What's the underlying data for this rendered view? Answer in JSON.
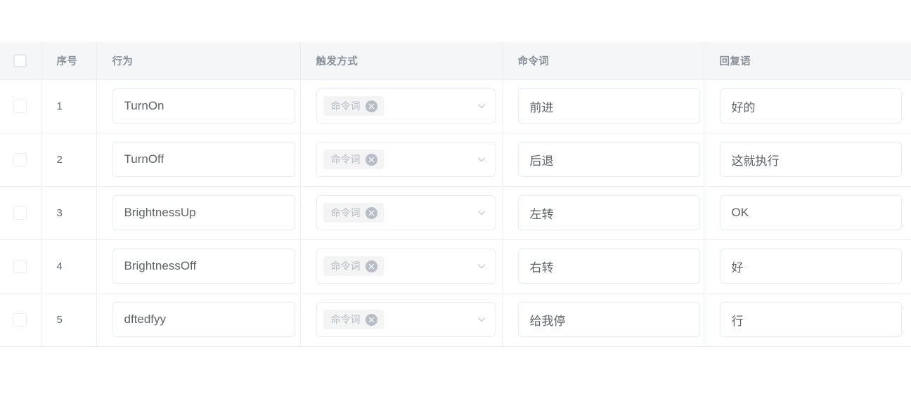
{
  "table": {
    "select_all_checkbox": "unchecked",
    "columns": [
      {
        "key": "check",
        "label": ""
      },
      {
        "key": "index",
        "label": "序号"
      },
      {
        "key": "action",
        "label": "行为"
      },
      {
        "key": "trigger",
        "label": "触发方式"
      },
      {
        "key": "command",
        "label": "命令词"
      },
      {
        "key": "reply",
        "label": "回复语"
      }
    ],
    "rows": [
      {
        "index": "1",
        "action": "TurnOn",
        "trigger_tag": "命令词",
        "command": "前进",
        "reply": "好的"
      },
      {
        "index": "2",
        "action": "TurnOff",
        "trigger_tag": "命令词",
        "command": "后退",
        "reply": "这就执行"
      },
      {
        "index": "3",
        "action": "BrightnessUp",
        "trigger_tag": "命令词",
        "command": "左转",
        "reply": "OK"
      },
      {
        "index": "4",
        "action": "BrightnessOff",
        "trigger_tag": "命令词",
        "command": "右转",
        "reply": "好"
      },
      {
        "index": "5",
        "action": "dftedfyy",
        "trigger_tag": "命令词",
        "command": "给我停",
        "reply": "行"
      }
    ]
  },
  "icons": {
    "tag_remove": "close-circle-icon",
    "dropdown": "chevron-down-icon",
    "checkbox": "checkbox-icon"
  },
  "colors": {
    "header_bg": "#f5f6f7",
    "header_text": "#8a9099",
    "row_border": "#f0f1f5",
    "field_border": "#ebeef2",
    "tag_bg": "#f4f4f5",
    "tag_text": "#b4bac2",
    "tag_close_bg": "#b7bcc6",
    "text": "#606266"
  }
}
